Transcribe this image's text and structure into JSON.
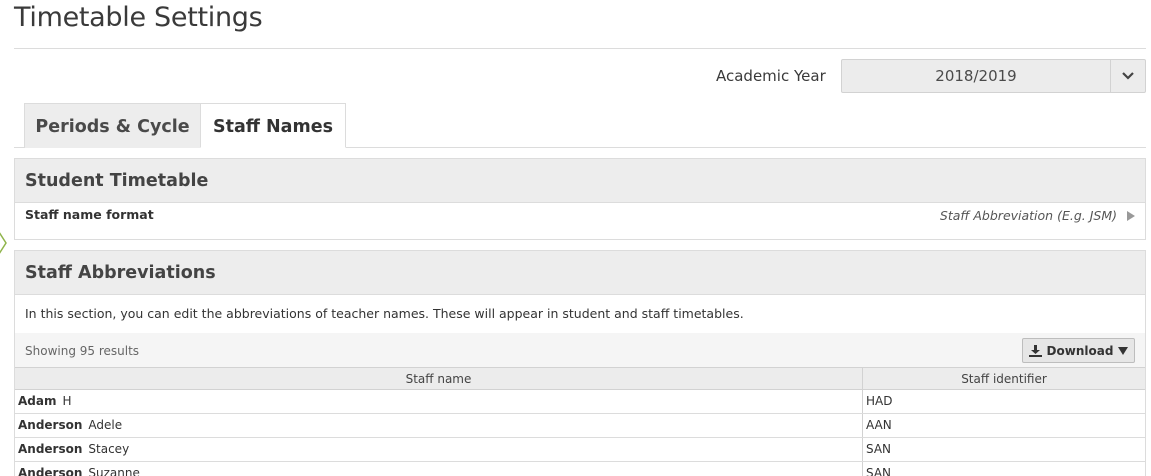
{
  "page": {
    "title": "Timetable Settings"
  },
  "academic_year": {
    "label": "Academic Year",
    "value": "2018/2019"
  },
  "tabs": [
    {
      "label": "Periods & Cycle",
      "active": false
    },
    {
      "label": "Staff Names",
      "active": true
    }
  ],
  "student_timetable": {
    "heading": "Student Timetable",
    "setting_label": "Staff name format",
    "setting_value": "Staff Abbreviation (E.g. JSM)"
  },
  "staff_abbreviations": {
    "heading": "Staff Abbreviations",
    "description": "In this section, you can edit the abbreviations of teacher names. These will appear in student and staff timetables.",
    "results": "Showing 95 results",
    "download_label": "Download",
    "columns": [
      "Staff name",
      "Staff identifier"
    ],
    "rows": [
      {
        "surname": "Adam",
        "forename": "H",
        "identifier": "HAD"
      },
      {
        "surname": "Anderson",
        "forename": "Adele",
        "identifier": "AAN"
      },
      {
        "surname": "Anderson",
        "forename": "Stacey",
        "identifier": "SAN"
      },
      {
        "surname": "Anderson",
        "forename": "Suzanne",
        "identifier": "SAN"
      }
    ]
  },
  "colors": {
    "panel_header": "#ededed",
    "border": "#dcdcdc",
    "text": "#333333"
  }
}
